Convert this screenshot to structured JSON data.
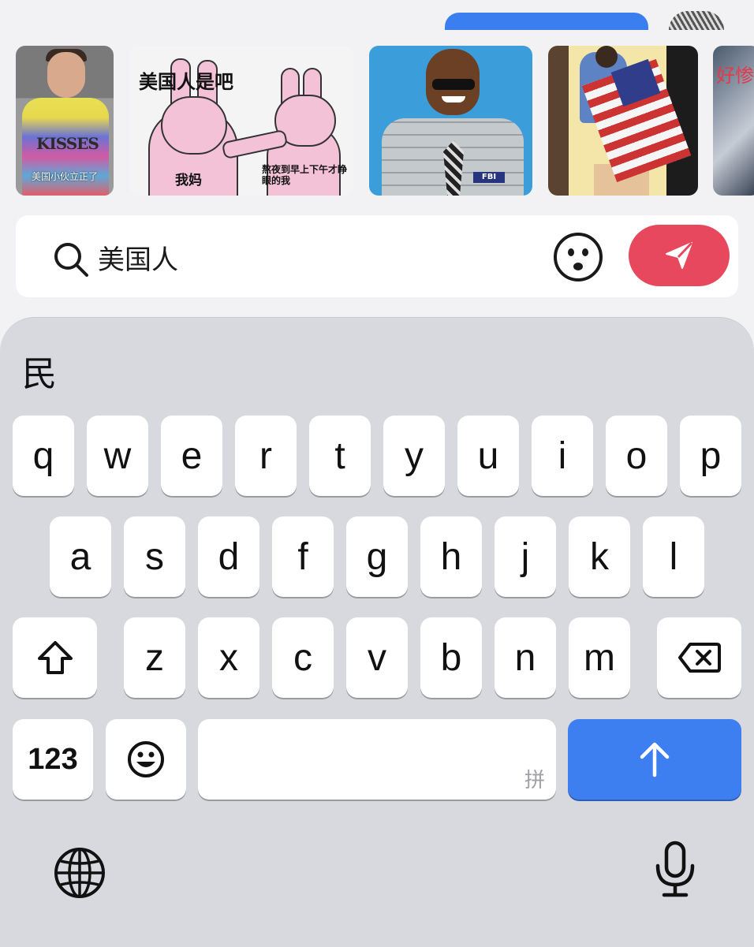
{
  "stickers": [
    {
      "caption": "美国小伙立正了",
      "text": "KISSES"
    },
    {
      "title": "美国人是吧",
      "left_label": "我妈",
      "right_label": "熬夜到早上下午才睁眼的我"
    },
    {
      "badge": "FBI"
    },
    {},
    {
      "text": "好惨"
    }
  ],
  "search": {
    "query": "美国人"
  },
  "keyboard": {
    "candidate": "民",
    "row1": [
      "q",
      "w",
      "e",
      "r",
      "t",
      "y",
      "u",
      "i",
      "o",
      "p"
    ],
    "row2": [
      "a",
      "s",
      "d",
      "f",
      "g",
      "h",
      "j",
      "k",
      "l"
    ],
    "row3": [
      "z",
      "x",
      "c",
      "v",
      "b",
      "n",
      "m"
    ],
    "numbers_label": "123",
    "space_hint": "拼"
  },
  "colors": {
    "send_button": "#e8485d",
    "return_key": "#3d7ff0"
  }
}
